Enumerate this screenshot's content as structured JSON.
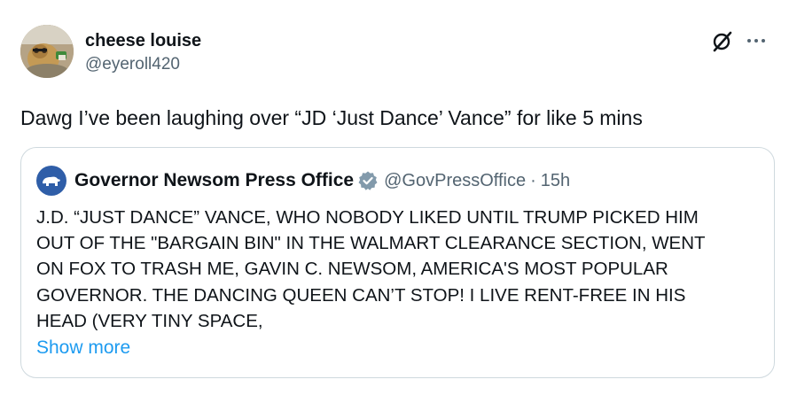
{
  "tweet": {
    "display_name": "cheese louise",
    "handle": "@eyeroll420",
    "text": "Dawg I’ve been laughing over “JD ‘Just Dance’ Vance” for like 5 mins"
  },
  "actions": {
    "grok_icon": "grok-icon",
    "more_icon": "more-icon",
    "more_label": "···"
  },
  "quote": {
    "display_name": "Governor Newsom Press Office",
    "handle": "@GovPressOffice",
    "separator": "·",
    "time": "15h",
    "verified_icon": "verified-badge-icon",
    "verified_color": "#829aab",
    "avatar_color": "#2f5ea8",
    "body_lines": [
      "J.D. “JUST DANCE” VANCE, WHO NOBODY LIKED UNTIL TRUMP PICKED HIM",
      "OUT OF THE \"BARGAIN BIN\" IN THE WALMART CLEARANCE SECTION, WENT",
      "ON FOX TO TRASH ME, GAVIN C. NEWSOM, AMERICA'S MOST POPULAR",
      "GOVERNOR. THE DANCING QUEEN CAN’T STOP! I LIVE RENT-FREE IN HIS",
      "HEAD (VERY TINY SPACE,"
    ],
    "show_more": "Show more"
  },
  "colors": {
    "text_primary": "#0f1419",
    "text_secondary": "#536471",
    "link": "#1d9bf0",
    "border": "#cfd9de"
  }
}
